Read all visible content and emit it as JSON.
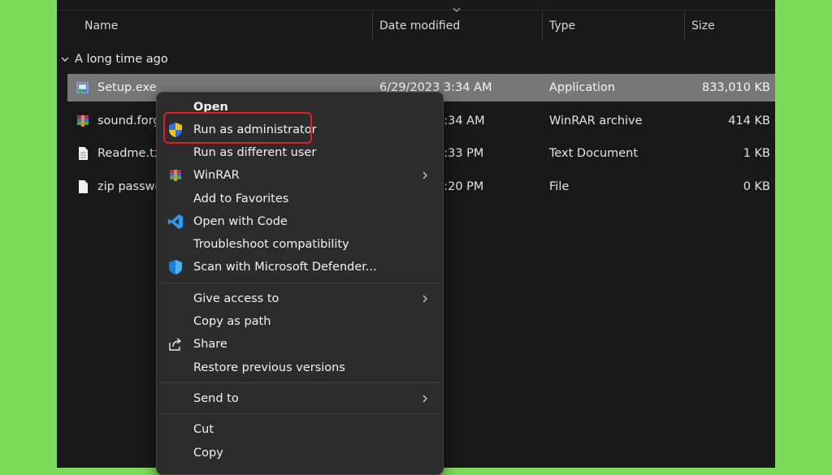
{
  "columns": {
    "name": "Name",
    "date_modified": "Date modified",
    "type": "Type",
    "size": "Size"
  },
  "group": {
    "label": "A long time ago"
  },
  "files": [
    {
      "name": "Setup.exe",
      "date": "6/29/2023 3:34 AM",
      "type": "Application",
      "size": "833,010 KB",
      "icon": "setup-exe-icon",
      "selected": true
    },
    {
      "name": "sound.forge",
      "date": "3:34 AM",
      "type": "WinRAR archive",
      "size": "414 KB",
      "icon": "winrar-archive-icon"
    },
    {
      "name": "Readme.txt",
      "date": "4:33 PM",
      "type": "Text Document",
      "size": "1 KB",
      "icon": "text-document-icon"
    },
    {
      "name": "zip passwo",
      "date": "1:20 PM",
      "type": "File",
      "size": "0 KB",
      "icon": "file-icon"
    }
  ],
  "context_menu": {
    "open": "Open",
    "run_as_admin": "Run as administrator",
    "run_as_different_user": "Run as different user",
    "winrar": "WinRAR",
    "add_to_favorites": "Add to Favorites",
    "open_with_code": "Open with Code",
    "troubleshoot": "Troubleshoot compatibility",
    "scan_defender": "Scan with Microsoft Defender...",
    "give_access": "Give access to",
    "copy_as_path": "Copy as path",
    "share": "Share",
    "restore_versions": "Restore previous versions",
    "send_to": "Send to",
    "cut": "Cut",
    "copy": "Copy"
  },
  "colors": {
    "background_accent": "#7ddb5a",
    "explorer_bg": "#191919",
    "menu_bg": "#2c2c2c",
    "highlight_border": "#e11c24",
    "selection": "#777777"
  }
}
